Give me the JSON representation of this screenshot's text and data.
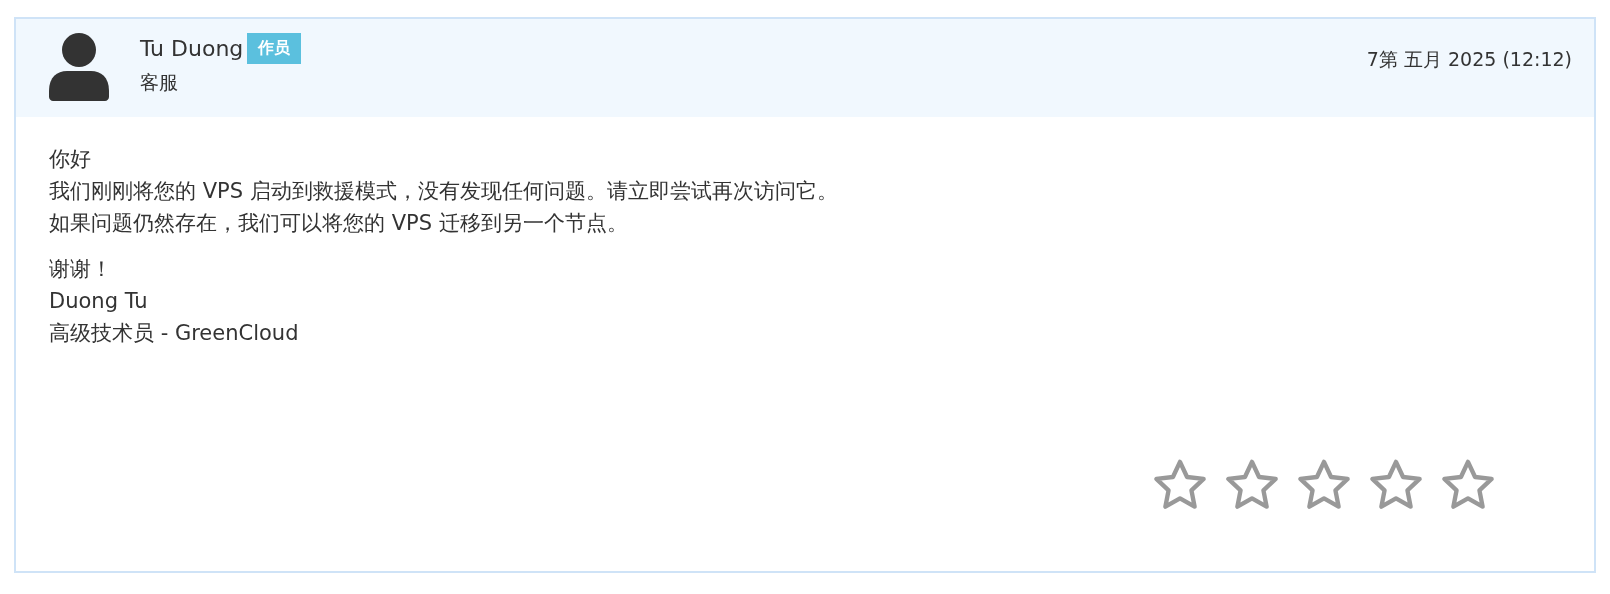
{
  "reply": {
    "author": "Tu Duong",
    "badge": "作员",
    "role": "客服",
    "date": "7第 五月 2025 (12:12)",
    "paragraphs": [
      [
        "你好",
        "我们刚刚将您的 VPS 启动到救援模式，没有发现任何问题。请立即尝试再次访问它。",
        "如果问题仍然存在，我们可以将您的 VPS 迁移到另一个节点。"
      ],
      [
        "谢谢！",
        "Duong Tu",
        "高级技术员 - GreenCloud"
      ]
    ],
    "rating": {
      "stars": 0
    }
  }
}
